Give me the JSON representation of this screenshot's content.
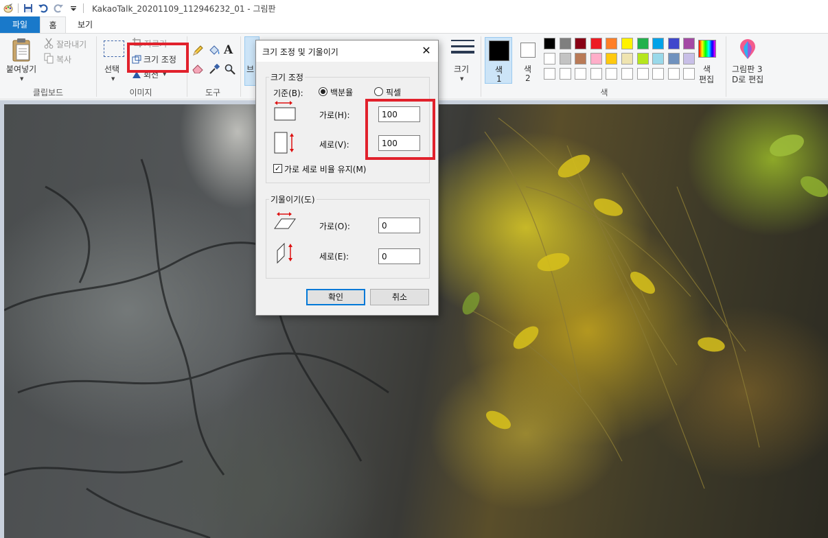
{
  "window": {
    "title": "KakaoTalk_20201109_112946232_01 - 그림판"
  },
  "tabs": {
    "file": "파일",
    "home": "홈",
    "view": "보기"
  },
  "ribbon": {
    "clipboard": {
      "paste": "붙여넣기",
      "cut": "잘라내기",
      "copy": "복사",
      "group_label": "클립보드"
    },
    "image": {
      "select": "선택",
      "crop": "자르기",
      "resize": "크기 조정",
      "rotate": "회전",
      "group_label": "이미지"
    },
    "tools": {
      "group_label": "도구"
    },
    "brushes": {
      "label_partial": "브"
    },
    "size": {
      "label": "크기"
    },
    "colors": {
      "color1_line1": "색",
      "color1_line2": "1",
      "color2_line1": "색",
      "color2_line2": "2",
      "edit_line1": "색",
      "edit_line2": "편집",
      "paint3d_line1": "그림판 3",
      "paint3d_line2": "D로 편집",
      "group_label": "색",
      "palette_row1": [
        "#000000",
        "#7f7f7f",
        "#880015",
        "#ed1c24",
        "#ff7f27",
        "#fff200",
        "#22b14c",
        "#00a2e8",
        "#3f48cc",
        "#a349a4"
      ],
      "palette_row2": [
        "#ffffff",
        "#c3c3c3",
        "#b97a57",
        "#ffaec9",
        "#ffc90e",
        "#efe4b0",
        "#b5e61d",
        "#99d9ea",
        "#7092be",
        "#c8bfe7"
      ],
      "palette_row3": [
        "#ffffff",
        "#ffffff",
        "#ffffff",
        "#ffffff",
        "#ffffff",
        "#ffffff",
        "#ffffff",
        "#ffffff",
        "#ffffff",
        "#ffffff"
      ]
    }
  },
  "dialog": {
    "title": "크기 조정 및 기울이기",
    "resize_group": "크기 조정",
    "by_label": "기준(B):",
    "percent_option": "백분율",
    "pixels_option": "픽셀",
    "horizontal_label": "가로(H):",
    "horizontal_value": "100",
    "vertical_label": "세로(V):",
    "vertical_value": "100",
    "maintain_ratio": "가로 세로 비율 유지(M)",
    "skew_group": "기울이기(도)",
    "skew_h_label": "가로(O):",
    "skew_h_value": "0",
    "skew_v_label": "세로(E):",
    "skew_v_value": "0",
    "ok": "확인",
    "cancel": "취소"
  },
  "accent_colors": {
    "file_tab": "#1979ca",
    "highlight_box": "#e1212c",
    "default_button_border": "#0078d7"
  }
}
